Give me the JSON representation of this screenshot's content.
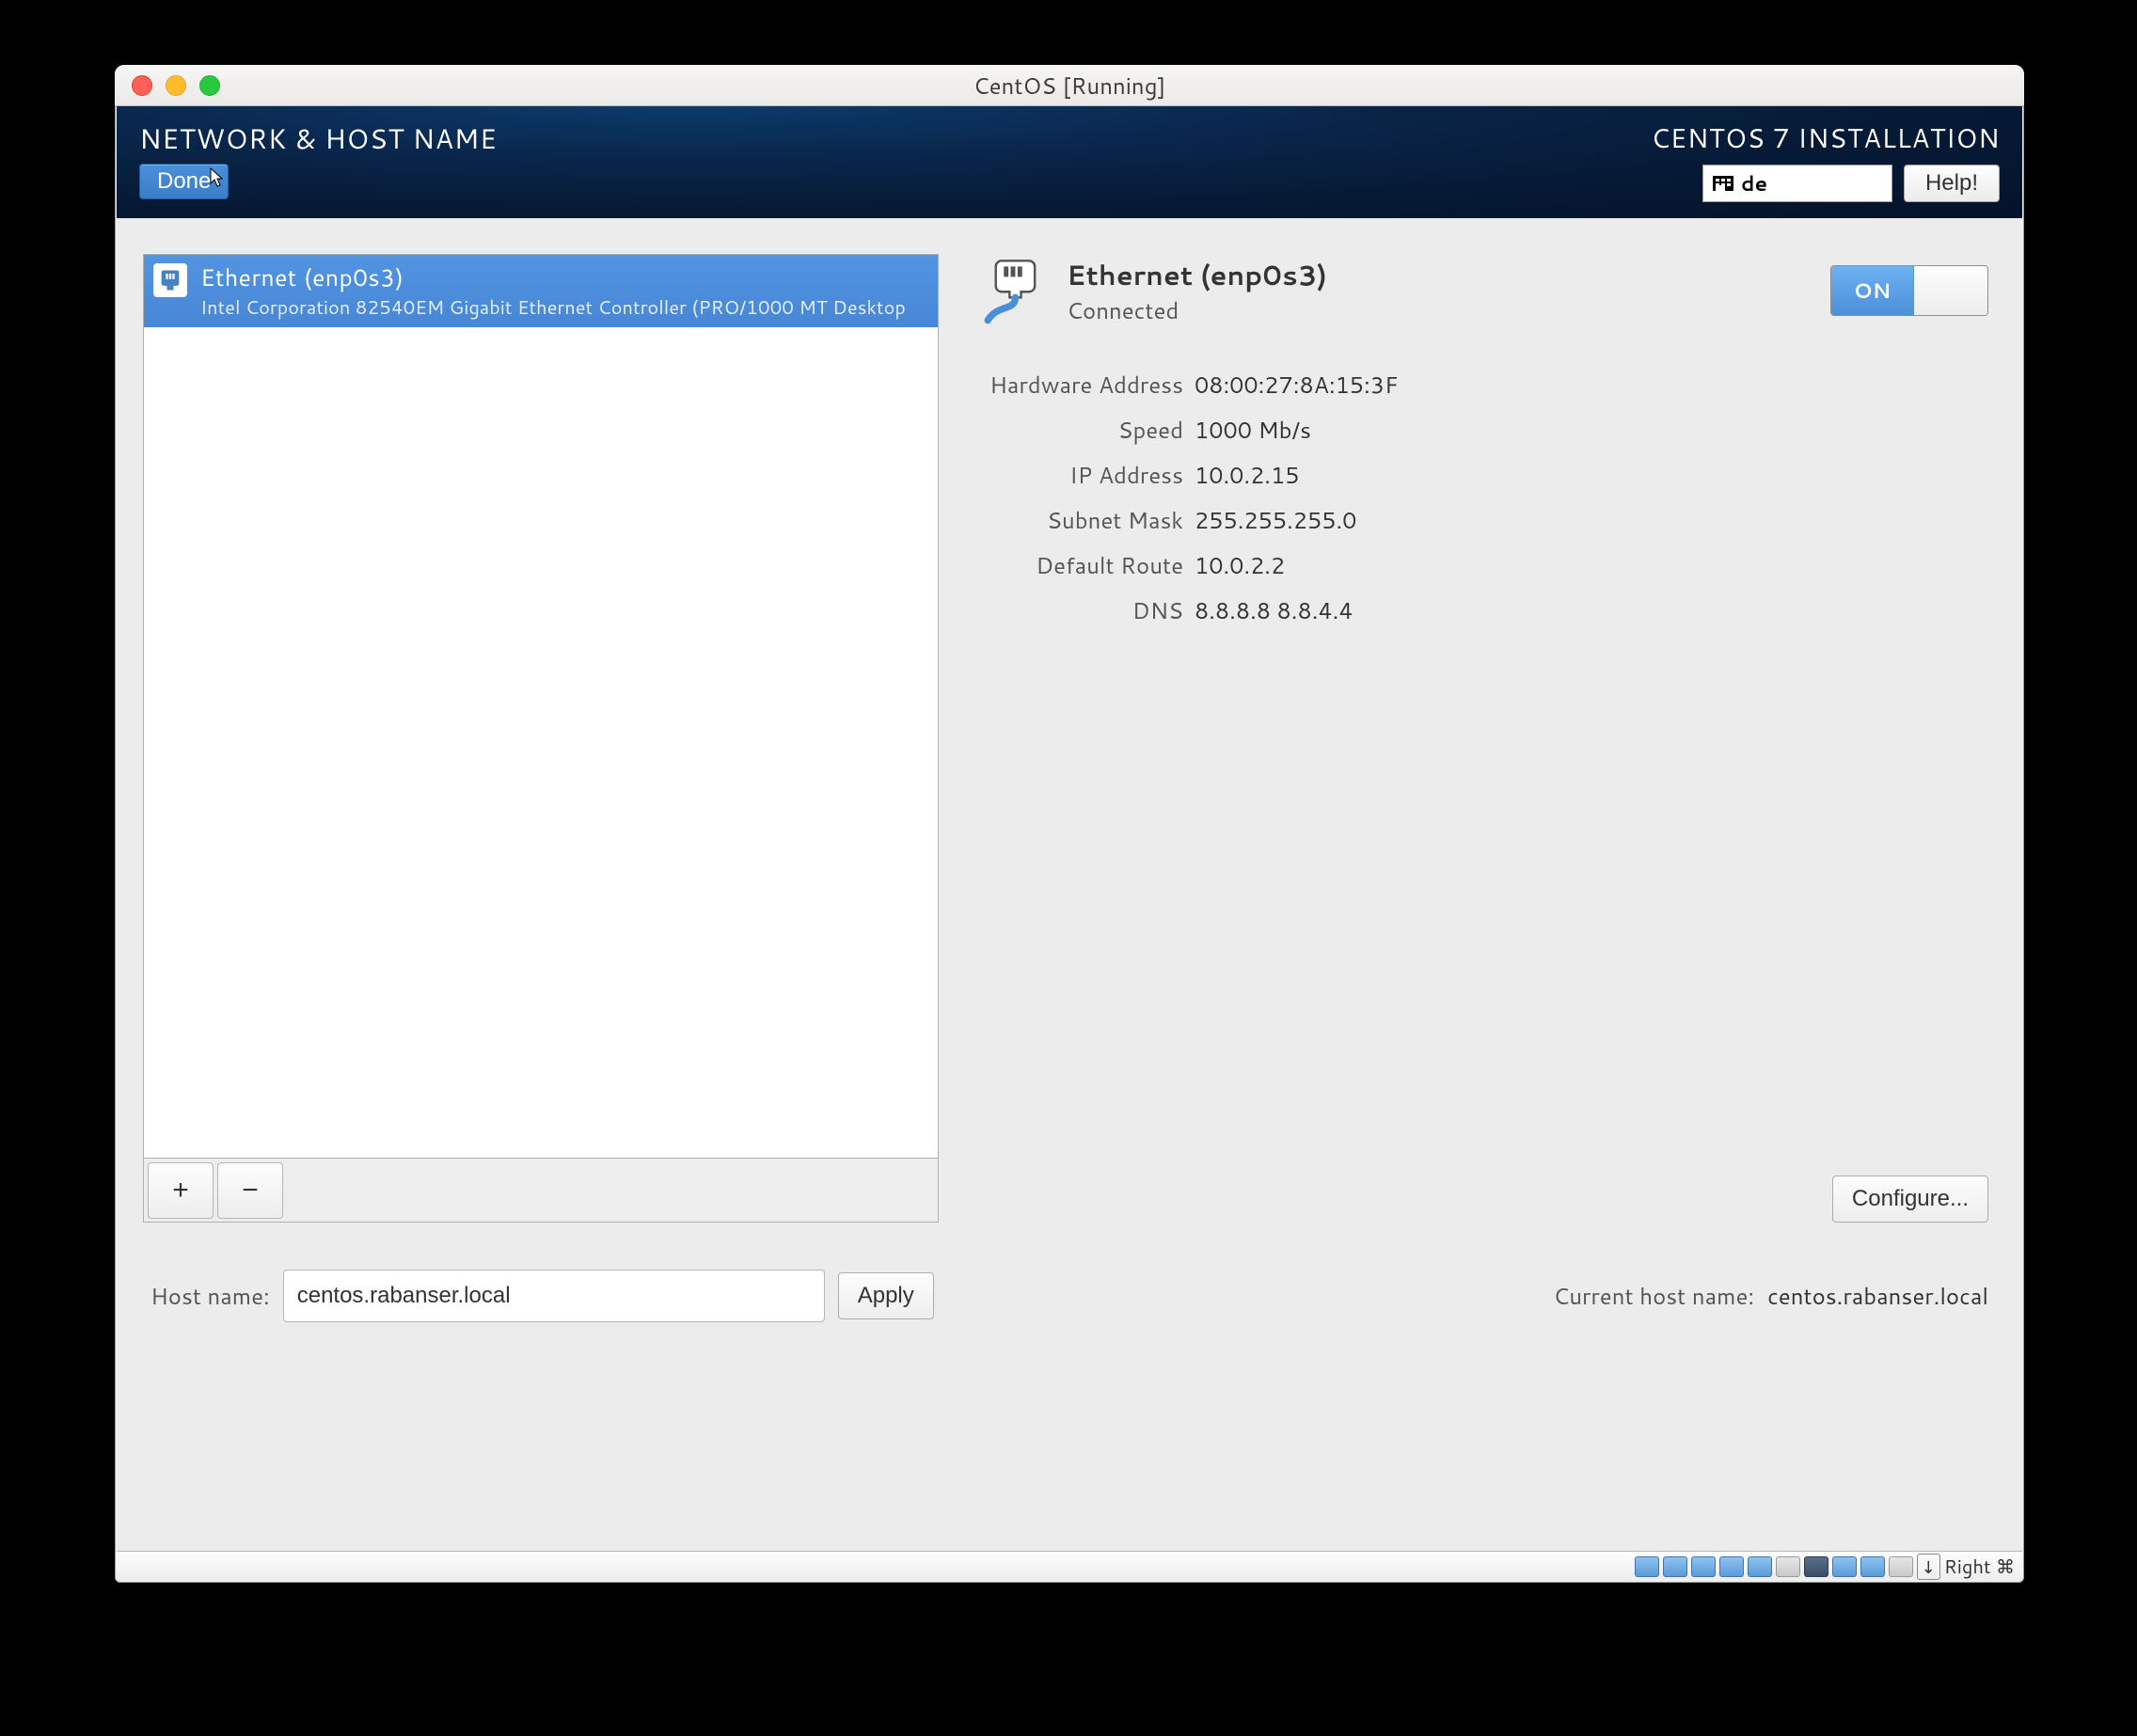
{
  "window": {
    "title": "CentOS [Running]"
  },
  "header": {
    "page_title": "NETWORK & HOST NAME",
    "done_label": "Done",
    "distro_label": "CENTOS 7 INSTALLATION",
    "keyboard_layout": "de",
    "help_label": "Help!"
  },
  "device_list": {
    "items": [
      {
        "title": "Ethernet (enp0s3)",
        "subtitle": "Intel Corporation 82540EM Gigabit Ethernet Controller (PRO/1000 MT Desktop"
      }
    ],
    "add_label": "+",
    "remove_label": "−"
  },
  "connection": {
    "title": "Ethernet (enp0s3)",
    "status": "Connected",
    "toggle_on": "ON",
    "details": [
      {
        "label": "Hardware Address",
        "value": "08:00:27:8A:15:3F"
      },
      {
        "label": "Speed",
        "value": "1000 Mb/s"
      },
      {
        "label": "IP Address",
        "value": "10.0.2.15"
      },
      {
        "label": "Subnet Mask",
        "value": "255.255.255.0"
      },
      {
        "label": "Default Route",
        "value": "10.0.2.2"
      },
      {
        "label": "DNS",
        "value": "8.8.8.8 8.8.4.4"
      }
    ],
    "configure_label": "Configure..."
  },
  "hostname": {
    "label": "Host name:",
    "value": "centos.rabanser.local",
    "apply_label": "Apply",
    "current_label": "Current host name:",
    "current_value": "centos.rabanser.local"
  },
  "statusbar": {
    "host_key": "Right ⌘"
  }
}
